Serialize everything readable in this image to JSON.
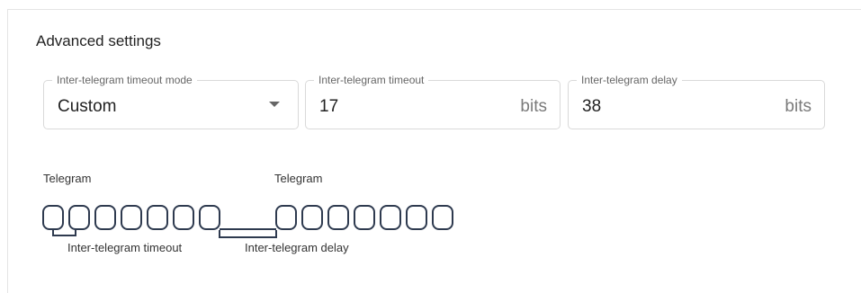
{
  "section": {
    "title": "Advanced settings"
  },
  "fields": {
    "mode": {
      "label": "Inter-telegram timeout mode",
      "value": "Custom"
    },
    "timeout": {
      "label": "Inter-telegram timeout",
      "value": "17",
      "suffix": "bits"
    },
    "delay": {
      "label": "Inter-telegram delay",
      "value": "38",
      "suffix": "bits"
    }
  },
  "diagram": {
    "telegram1_label": "Telegram",
    "telegram2_label": "Telegram",
    "timeout_label": "Inter-telegram timeout",
    "delay_label": "Inter-telegram delay",
    "bits_per_telegram": 7,
    "stroke_color": "#2e3a4f"
  }
}
